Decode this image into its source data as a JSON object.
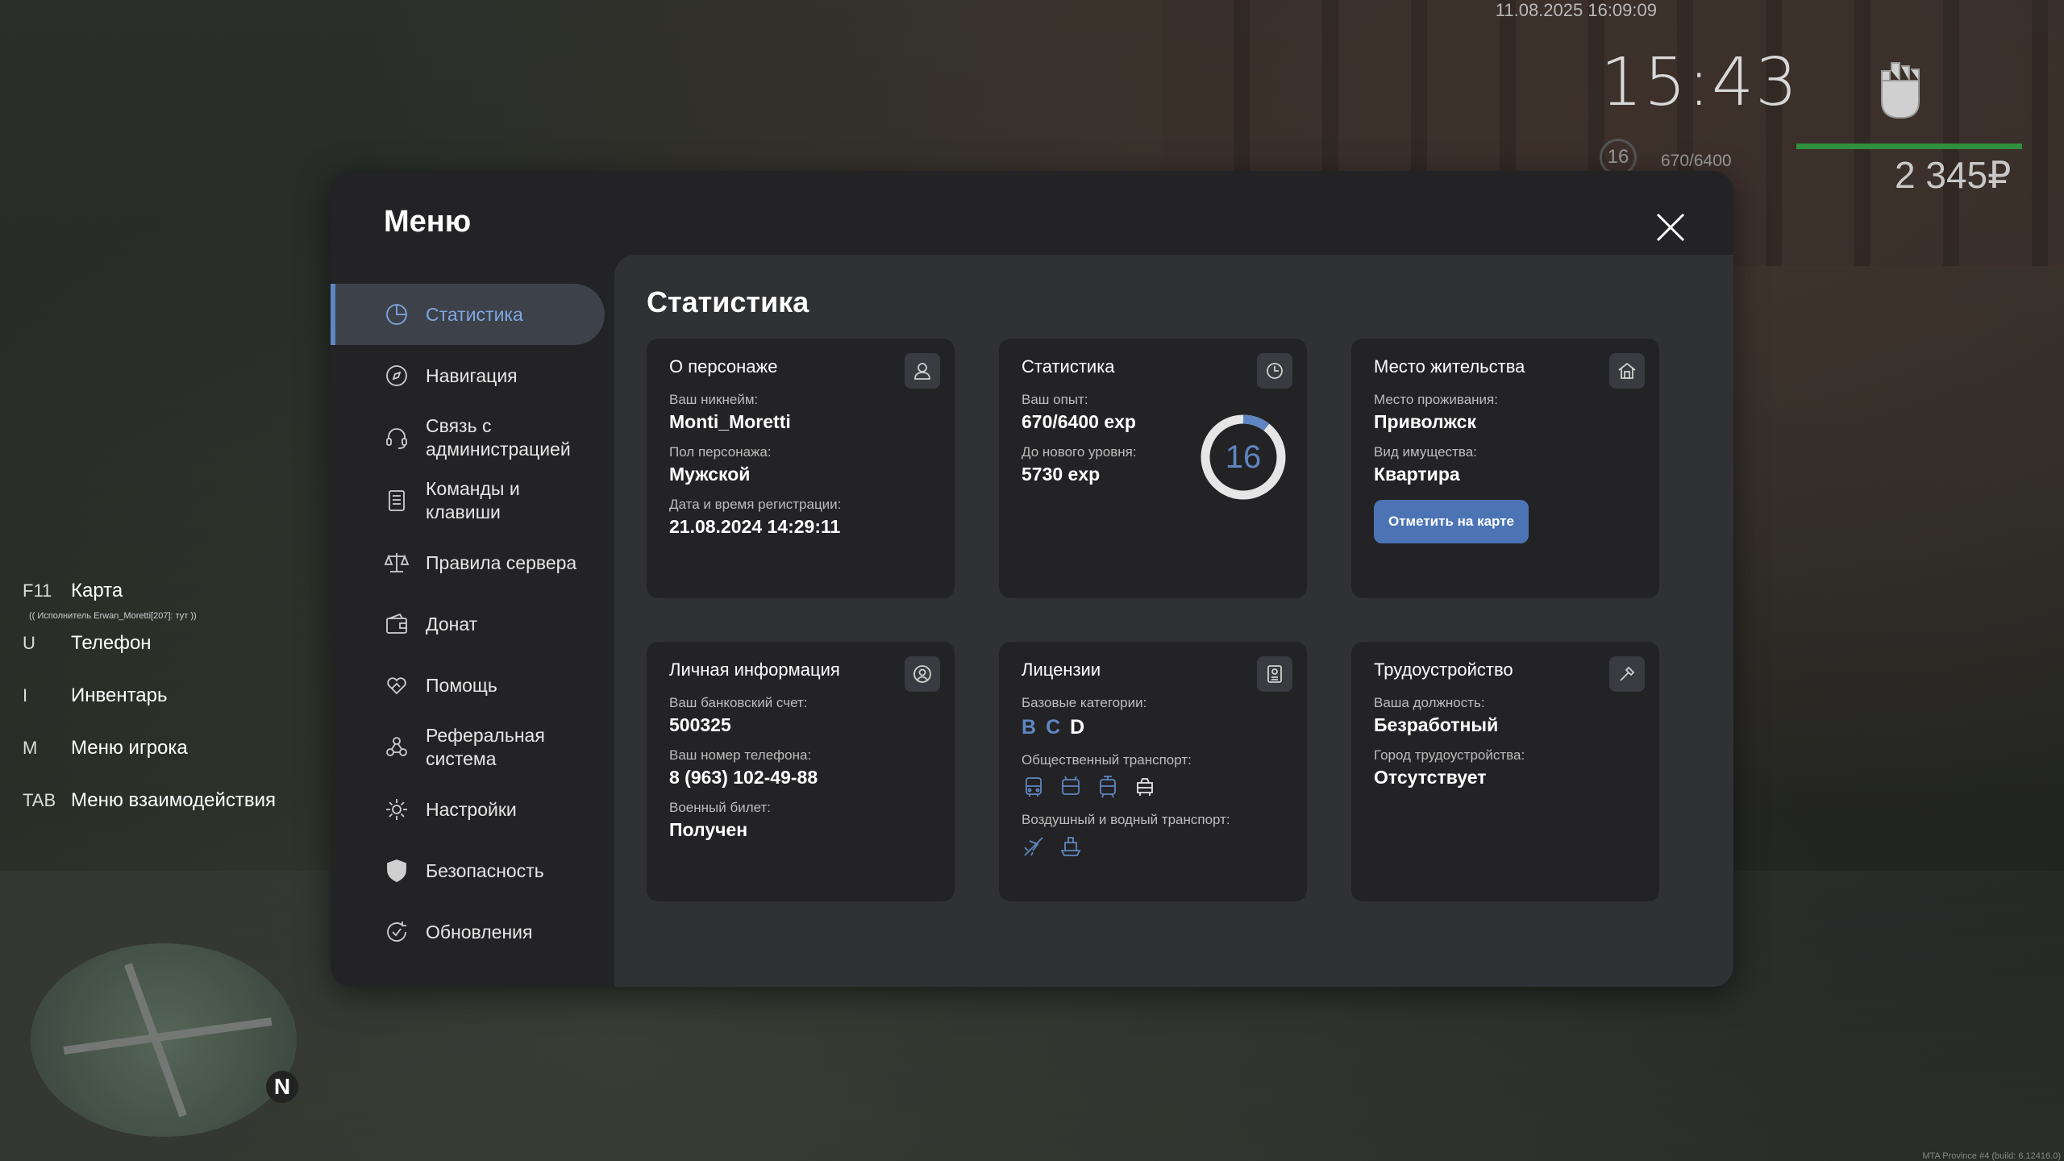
{
  "hud": {
    "datetime": "11.08.2025 16:09:09",
    "clock": "15:43",
    "level": "16",
    "exp": "670/6400",
    "money": "2 345₽",
    "hp_color": "#2f8f3c"
  },
  "hotkeys": [
    {
      "key": "F11",
      "label": "Карта"
    },
    {
      "key": "U",
      "label": "Телефон"
    },
    {
      "key": "I",
      "label": "Инвентарь"
    },
    {
      "key": "M",
      "label": "Меню игрока"
    },
    {
      "key": "TAB",
      "label": "Меню взаимодействия"
    }
  ],
  "chat_line": "(( Исполнитель Erwan_Moretti[207]: тут ))",
  "minimap": {
    "north": "N"
  },
  "build_info": "MTA Province #4 (build: 6.12416.0)",
  "menu": {
    "title": "Меню",
    "sidebar": [
      {
        "label": "Статистика",
        "icon": "pie-chart-icon"
      },
      {
        "label": "Навигация",
        "icon": "compass-icon"
      },
      {
        "label": "Связь с администрацией",
        "icon": "headset-icon"
      },
      {
        "label": "Команды и клавиши",
        "icon": "document-list-icon"
      },
      {
        "label": "Правила сервера",
        "icon": "scales-icon"
      },
      {
        "label": "Донат",
        "icon": "wallet-icon"
      },
      {
        "label": "Помощь",
        "icon": "heart-hand-icon"
      },
      {
        "label": "Реферальная система",
        "icon": "people-network-icon"
      },
      {
        "label": "Настройки",
        "icon": "gear-icon"
      },
      {
        "label": "Безопасность",
        "icon": "shield-icon"
      },
      {
        "label": "Обновления",
        "icon": "refresh-check-icon"
      }
    ],
    "content_title": "Статистика",
    "cards": {
      "about": {
        "title": "О персонаже",
        "nick_label": "Ваш никнейм:",
        "nick": "Monti_Moretti",
        "gender_label": "Пол персонажа:",
        "gender": "Мужской",
        "reg_label": "Дата и время регистрации:",
        "reg": "21.08.2024 14:29:11"
      },
      "stats": {
        "title": "Статистика",
        "exp_label": "Ваш опыт:",
        "exp": "670/6400 exp",
        "next_label": "До нового уровня:",
        "next": "5730 exp",
        "level": "16",
        "progress": 0.105,
        "accent": "#5e86c2"
      },
      "residence": {
        "title": "Место жительства",
        "place_label": "Место проживания:",
        "place": "Приволжск",
        "property_label": "Вид имущества:",
        "property": "Квартира",
        "button": "Отметить на карте"
      },
      "personal": {
        "title": "Личная информация",
        "bank_label": "Ваш банковский счет:",
        "bank": "500325",
        "phone_label": "Ваш номер телефона:",
        "phone": "8 (963) 102-49-88",
        "military_label": "Военный билет:",
        "military": "Получен"
      },
      "licenses": {
        "title": "Лицензии",
        "base_label": "Базовые категории:",
        "categories": [
          {
            "letter": "B",
            "color": "#5e86c2"
          },
          {
            "letter": "C",
            "color": "#5e86c2"
          },
          {
            "letter": "D",
            "color": "#ffffff"
          }
        ],
        "public_label": "Общественный транспорт:",
        "air_label": "Воздушный и водный транспорт:"
      },
      "employment": {
        "title": "Трудоустройство",
        "position_label": "Ваша должность:",
        "position": "Безработный",
        "city_label": "Город трудоустройства:",
        "city": "Отсутствует"
      }
    }
  }
}
